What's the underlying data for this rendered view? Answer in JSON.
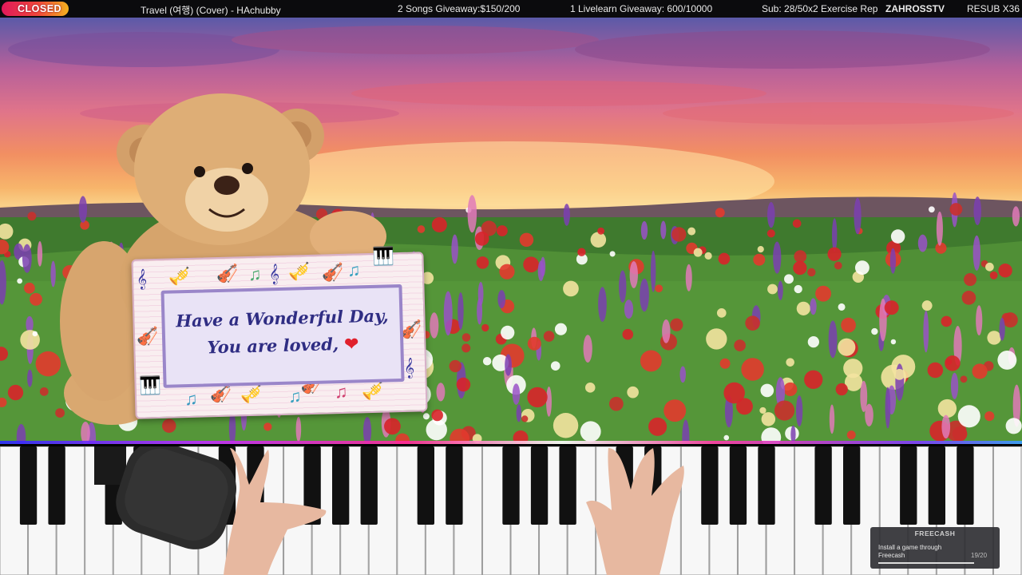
{
  "topbar": {
    "status_badge": "CLOSED",
    "song": "Travel (여행) (Cover) - HAchubby",
    "songs_giveaway": "2 Songs Giveaway:$150/200",
    "livelearn_giveaway": "1 Livelearn Giveaway: 600/10000",
    "sub_goal": "Sub: 28/50x2 Exercise Rep",
    "channel": "ZAHROSSTV",
    "resub": "RESUB X36"
  },
  "sign": {
    "line1": "Have a Wonderful Day,",
    "line2": "You are loved,",
    "heart": "❤"
  },
  "ad": {
    "brand": "FREECASH",
    "line1": "Install a game through",
    "line2": "Freecash",
    "page": "19/20"
  },
  "colors": {
    "badge_gradient": [
      "#e0195b",
      "#f5b21e"
    ],
    "sign_text": "#2f2d83",
    "sign_frame": "#9a86c9"
  },
  "icons": [
    "treble-clef-icon",
    "trumpet-icon",
    "violin-icon",
    "music-note-icon",
    "grand-piano-icon",
    "heart-icon"
  ]
}
